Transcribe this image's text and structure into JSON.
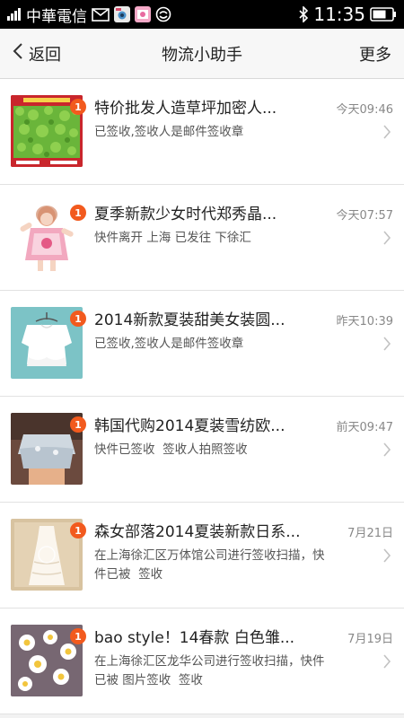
{
  "statusbar": {
    "carrier": "中華電信",
    "time": "11:35"
  },
  "navbar": {
    "back_label": "返回",
    "title": "物流小助手",
    "more_label": "更多"
  },
  "items": [
    {
      "title": "特价批发人造草坪加密人...",
      "time": "今天09:46",
      "desc": "已签收,签收人是邮件签收章",
      "badge": "1",
      "thumb": "grass"
    },
    {
      "title": "夏季新款少女时代郑秀晶...",
      "time": "今天07:57",
      "desc": "快件离开 上海 已发往 下徐汇",
      "badge": "1",
      "thumb": "girl"
    },
    {
      "title": "2014新款夏装甜美女装圆...",
      "time": "昨天10:39",
      "desc": "已签收,签收人是邮件签收章",
      "badge": "1",
      "thumb": "blouse"
    },
    {
      "title": "韩国代购2014夏装雪纺欧...",
      "time": "前天09:47",
      "desc": "快件已签收  签收人拍照签收",
      "badge": "1",
      "thumb": "chiffon"
    },
    {
      "title": "森女部落2014夏装新款日系...",
      "time": "7月21日",
      "desc": "在上海徐汇区万体馆公司进行签收扫描，快件已被  签收",
      "badge": "1",
      "thumb": "dress"
    },
    {
      "title": "bao style！14春款 白色雏...",
      "time": "7月19日",
      "desc": "在上海徐汇区龙华公司进行签收扫描，快件已被 图片签收  签收",
      "badge": "1",
      "thumb": "daisy"
    }
  ]
}
